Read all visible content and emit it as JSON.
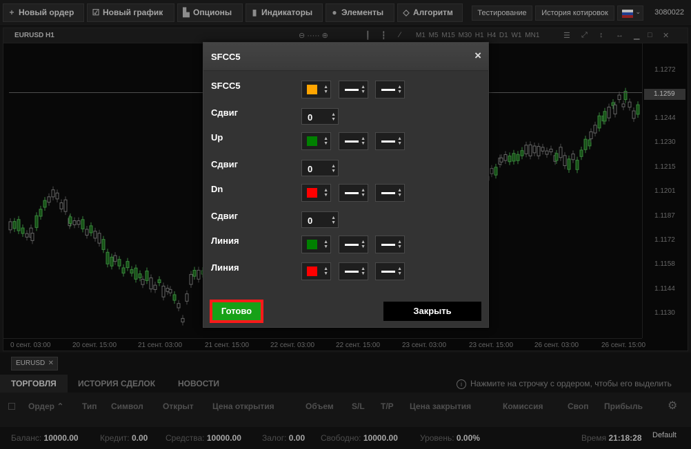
{
  "toolbar": {
    "buttons": [
      {
        "label": "Новый ордер",
        "icon": "plus-icon"
      },
      {
        "label": "Новый график",
        "icon": "chart-check-icon"
      },
      {
        "label": "Опционы",
        "icon": "options-icon"
      },
      {
        "label": "Индикаторы",
        "icon": "bar-chart-icon"
      },
      {
        "label": "Элементы",
        "icon": "elements-icon"
      },
      {
        "label": "Алгоритм",
        "icon": "diamond-icon"
      }
    ],
    "testing": "Тестирование",
    "quotes_history": "История котировок",
    "account": "3080022"
  },
  "chart": {
    "symbol_title": "EURUSD H1",
    "timeframes": "M1 M5 M15 M30 H1 H4 D1 W1 MN1",
    "y_labels": [
      "1.1272",
      "1.1244",
      "1.1230",
      "1.1215",
      "1.1201",
      "1.1187",
      "1.1172",
      "1.1158",
      "1.1144",
      "1.1130"
    ],
    "current_price": "1.1259",
    "x_labels": [
      "0 сент. 03:00",
      "20 сент. 15:00",
      "21 сент. 03:00",
      "21 сент. 15:00",
      "22 сент. 03:00",
      "22 сент. 15:00",
      "23 сент. 03:00",
      "23 сент. 15:00",
      "26 сент. 03:00",
      "26 сент. 15:00"
    ]
  },
  "symbol_tab": "EURUSD",
  "modal": {
    "title": "SFCC5",
    "close_glyph": "×",
    "params": [
      {
        "label": "SFCC5",
        "kind": "line",
        "color": "#ffa500"
      },
      {
        "label": "Сдвиг",
        "kind": "number",
        "value": "0"
      },
      {
        "label": "Up",
        "kind": "line",
        "color": "#008000"
      },
      {
        "label": "Сдвиг",
        "kind": "number",
        "value": "0"
      },
      {
        "label": "Dn",
        "kind": "line",
        "color": "#ff0000"
      },
      {
        "label": "Сдвиг",
        "kind": "number",
        "value": "0"
      },
      {
        "label": "Линия",
        "kind": "line",
        "color": "#008000"
      },
      {
        "label": "Линия",
        "kind": "line",
        "color": "#ff0000"
      }
    ],
    "ok_label": "Готово",
    "close_label": "Закрыть"
  },
  "bottom": {
    "tabs": [
      "ТОРГОВЛЯ",
      "ИСТОРИЯ СДЕЛОК",
      "НОВОСТИ"
    ],
    "hint": "Нажмите на строчку с ордером, чтобы его выделить",
    "columns": [
      "Ордер ⌃",
      "Тип",
      "Символ",
      "Открыт",
      "Цена открытия",
      "Объем",
      "S/L",
      "T/P",
      "Цена закрытия",
      "Комиссия",
      "Своп",
      "Прибыль"
    ],
    "status": [
      {
        "label": "Баланс:",
        "value": "10000.00"
      },
      {
        "label": "Кредит:",
        "value": "0.00"
      },
      {
        "label": "Средства:",
        "value": "10000.00"
      },
      {
        "label": "Залог:",
        "value": "0.00"
      },
      {
        "label": "Свободно:",
        "value": "10000.00"
      },
      {
        "label": "Уровень:",
        "value": "0.00%"
      }
    ],
    "time_label": "Время",
    "time_value": "21:18:28",
    "profile": "Default"
  }
}
